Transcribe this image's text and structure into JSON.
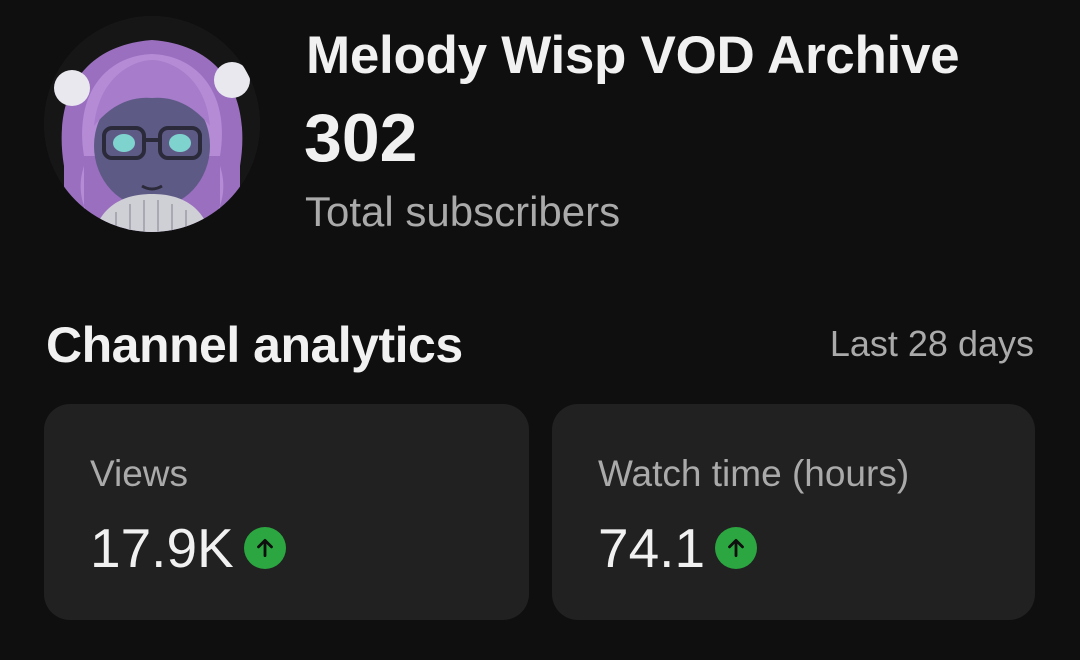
{
  "channel": {
    "name": "Melody Wisp VOD Archive",
    "subscriber_count": "302",
    "subscriber_label": "Total subscribers",
    "avatar_icon": "channel-avatar-image"
  },
  "analytics": {
    "title": "Channel analytics",
    "range": "Last 28 days",
    "cards": [
      {
        "label": "Views",
        "value": "17.9K",
        "trend": "up",
        "trend_icon": "arrow-up-icon"
      },
      {
        "label": "Watch time (hours)",
        "value": "74.1",
        "trend": "up",
        "trend_icon": "arrow-up-icon"
      }
    ]
  },
  "colors": {
    "background": "#0f0f0f",
    "card": "#212121",
    "text_primary": "#f1f1f1",
    "text_secondary": "#aaaaaa",
    "trend_up": "#2ba640"
  }
}
